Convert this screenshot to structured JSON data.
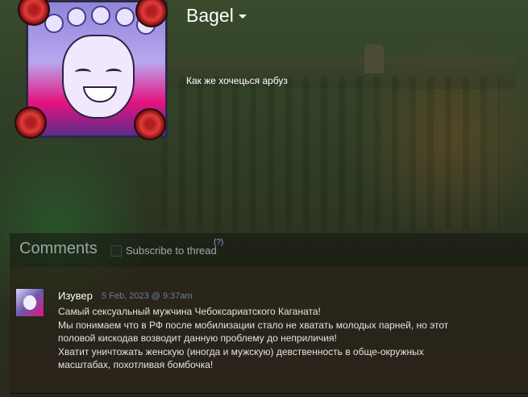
{
  "profile": {
    "username": "Bagel",
    "status": "Как же хочецься арбуз"
  },
  "comments": {
    "title": "Comments",
    "subscribe_label": "Subscribe to thread",
    "help_label": "(?)",
    "items": [
      {
        "author": "Изувер",
        "timestamp": "5 Feb, 2023 @ 9:37am",
        "lines": [
          "Самый сексуальный мужчина Чебоксариатского Каганата!",
          "Мы понимаем что в РФ после мобилизации стало не хватать молодых парней, но этот",
          "половой кискодав возводит данную проблему до неприличия!",
          "Хватит уничтожать женскую (иногда и мужскую) девственность в обще-окружных",
          "масштабах, похотливая бомбочка!"
        ]
      }
    ]
  },
  "icons": {
    "caret": "chevron-down-icon",
    "checkbox": "checkbox-icon"
  }
}
